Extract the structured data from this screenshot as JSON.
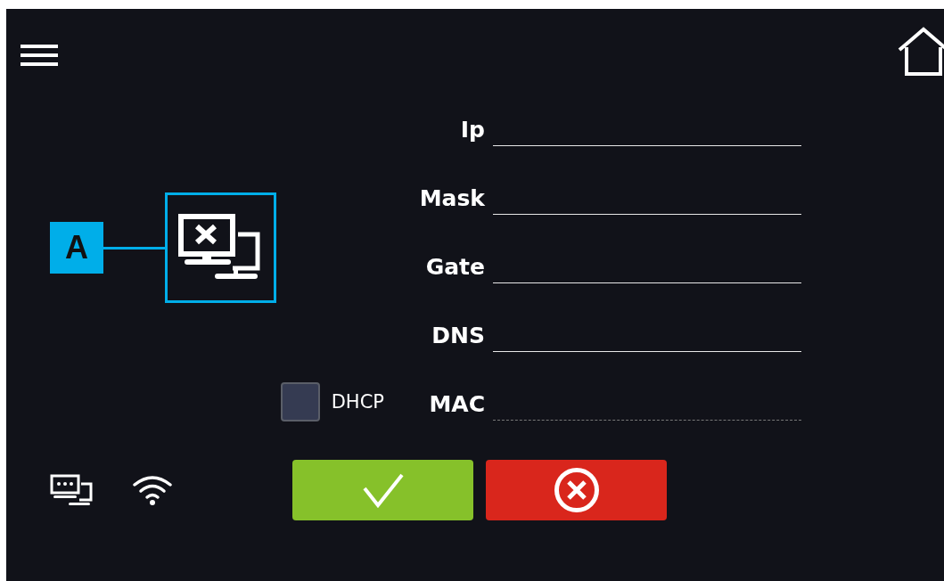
{
  "callout": {
    "label": "A"
  },
  "fields": [
    {
      "label": "Ip",
      "kind": "input"
    },
    {
      "label": "Mask",
      "kind": "input"
    },
    {
      "label": "Gate",
      "kind": "input"
    },
    {
      "label": "DNS",
      "kind": "input"
    },
    {
      "label": "MAC",
      "kind": "readonly"
    }
  ],
  "dhcp": {
    "label": "DHCP",
    "checked": false
  }
}
